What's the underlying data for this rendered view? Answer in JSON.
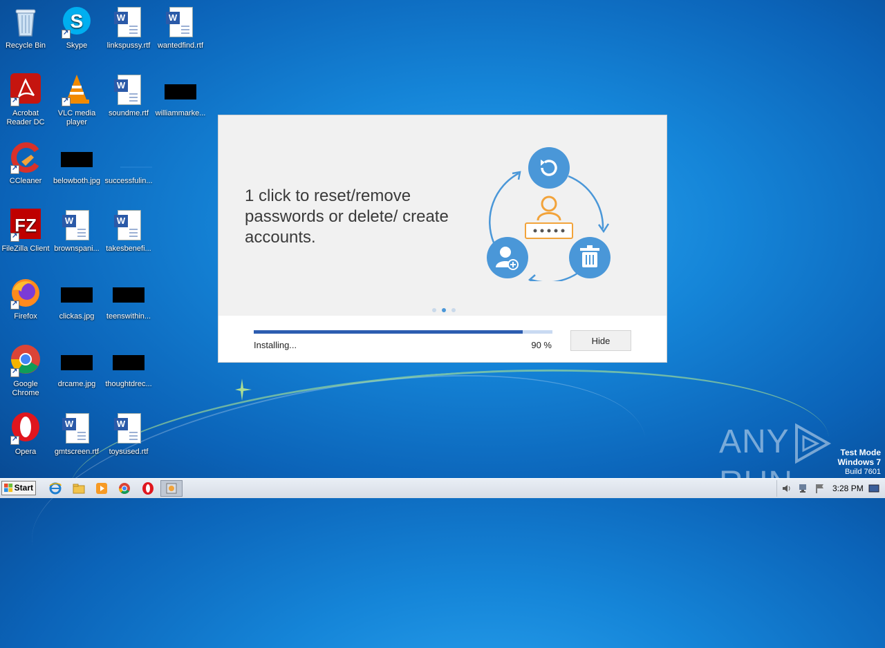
{
  "desktop": {
    "icons": [
      {
        "label": "Recycle Bin"
      },
      {
        "label": "Skype"
      },
      {
        "label": "linkspussy.rtf"
      },
      {
        "label": "wantedfind.rtf"
      },
      {
        "label": "Acrobat Reader DC"
      },
      {
        "label": "VLC media player"
      },
      {
        "label": "soundme.rtf"
      },
      {
        "label": "williammarke..."
      },
      {
        "label": "CCleaner"
      },
      {
        "label": "belowboth.jpg"
      },
      {
        "label": "successfulin..."
      },
      {
        "label": "FileZilla Client"
      },
      {
        "label": "brownspani..."
      },
      {
        "label": "takesbenefi..."
      },
      {
        "label": "Firefox"
      },
      {
        "label": "clickas.jpg"
      },
      {
        "label": "teenswithin..."
      },
      {
        "label": "Google Chrome"
      },
      {
        "label": "drcame.jpg"
      },
      {
        "label": "thoughtdrec..."
      },
      {
        "label": "Opera"
      },
      {
        "label": "gmtscreen.rtf"
      },
      {
        "label": "toysused.rtf"
      }
    ]
  },
  "installer": {
    "headline": "1 click to reset/remove passwords or delete/ create accounts.",
    "carousel": {
      "count": 3,
      "active_index": 1
    },
    "progress_percent": 90,
    "status_text": "Installing...",
    "percent_text": "90 %",
    "hide_label": "Hide",
    "accent_color": "#4a97d8",
    "progress_color": "#2d5db0"
  },
  "watermark": {
    "text_left": "ANY",
    "text_right": "RUN"
  },
  "system": {
    "test_mode": "Test Mode",
    "os": "Windows 7",
    "build": "Build 7601"
  },
  "taskbar": {
    "start_label": "Start",
    "pinned": [
      "internet-explorer-icon",
      "file-explorer-icon",
      "media-player-icon",
      "chrome-icon",
      "opera-icon",
      "installer-app-icon"
    ],
    "clock": "3:28 PM"
  }
}
